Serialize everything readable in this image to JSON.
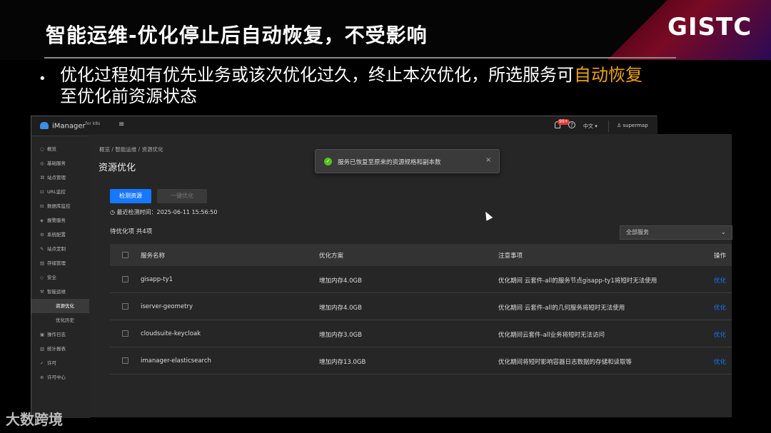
{
  "slide": {
    "title": "智能运维-优化停止后自动恢复，不受影响",
    "logo": "GISTC",
    "bullet_normal": "优化过程如有优先业务或该次优化过久，终止本次优化，所选服务可",
    "bullet_highlight": "自动恢复",
    "bullet_tail": "至优化前资源状态",
    "watermark": "大数跨境",
    "highlight_color": "#f0a30a"
  },
  "ui": {
    "app_name": "iManager",
    "app_sup": "for k8s",
    "menu_icon": "≡",
    "badge": "99+",
    "help": "?",
    "language": "中文 ▾",
    "user": "supermap",
    "sidebar": [
      {
        "icon": "○",
        "label": "概览"
      },
      {
        "icon": "◎",
        "label": "基础服务"
      },
      {
        "icon": "⌘",
        "label": "站点管理"
      },
      {
        "icon": "⊡",
        "label": "URL监控"
      },
      {
        "icon": "⊟",
        "label": "数据库监控"
      },
      {
        "icon": "◈",
        "label": "报警服务"
      },
      {
        "icon": "⚙",
        "label": "系统配置"
      },
      {
        "icon": "✎",
        "label": "站点定制"
      },
      {
        "icon": "▤",
        "label": "存储管理"
      },
      {
        "icon": "◇",
        "label": "安全"
      },
      {
        "icon": "⚒",
        "label": "智能运维"
      },
      {
        "icon": "",
        "label": "资源优化"
      },
      {
        "icon": "",
        "label": "优化历史"
      },
      {
        "icon": "▣",
        "label": "操作日志"
      },
      {
        "icon": "▥",
        "label": "统计报表"
      },
      {
        "icon": "✓",
        "label": "许可"
      },
      {
        "icon": "⊕",
        "label": "许可中心"
      }
    ],
    "breadcrumb": "概览  /  智能运维  /  资源优化",
    "page_title": "资源优化",
    "btn_detect": "检测资源",
    "btn_optimize": "一键优化",
    "last_check": "◷ 最近检测时间：2025-06-11 15:56:50",
    "pending_label": "待优化项",
    "pending_count": "共4项",
    "select_value": "全部服务",
    "toast_text": "服务已恢复至原来的资源规格和副本数",
    "toast_close": "×",
    "headers": {
      "name": "服务名称",
      "plan": "优化方案",
      "note": "注意事项",
      "action": "操作"
    },
    "rows": [
      {
        "name": "gisapp-ty1",
        "plan": "增加内存4.0GB",
        "note": "优化期间 云套件-all的服务节点gisapp-ty1将短时无法使用",
        "action": "优化"
      },
      {
        "name": "iserver-geometry",
        "plan": "增加内存4.0GB",
        "note": "优化期间 云套件-all的几何服务将短时无法使用",
        "action": "优化"
      },
      {
        "name": "cloudsuite-keycloak",
        "plan": "增加内存3.0GB",
        "note": "优化期间云套件-all业务将短时无法访问",
        "action": "优化"
      },
      {
        "name": "imanager-elasticsearch",
        "plan": "增加内存13.0GB",
        "note": "优化期间将短时影响容器日志数据的存储和读取等",
        "action": "优化"
      }
    ]
  }
}
